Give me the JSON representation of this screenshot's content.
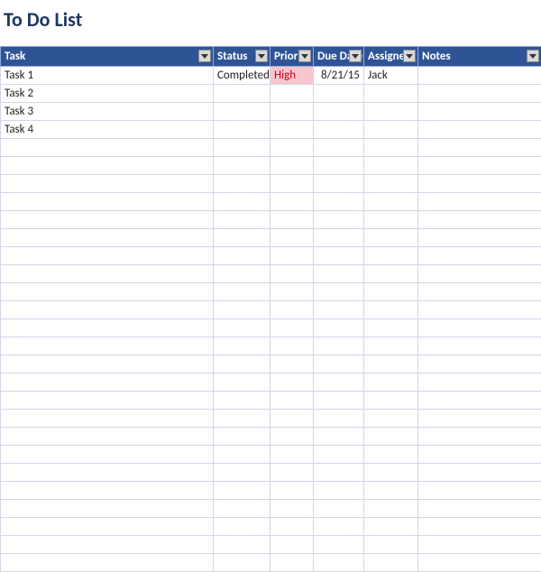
{
  "title": "To Do List",
  "columns": {
    "task": "Task",
    "status": "Status",
    "priority": "Priority",
    "duedate": "Due Date",
    "assignee": "Assignee",
    "notes": "Notes"
  },
  "rows": [
    {
      "task": "Task 1",
      "status": "Completed",
      "priority": "High",
      "duedate": "8/21/15",
      "assignee": "Jack",
      "notes": ""
    },
    {
      "task": "Task 2",
      "status": "",
      "priority": "",
      "duedate": "",
      "assignee": "",
      "notes": ""
    },
    {
      "task": "Task 3",
      "status": "",
      "priority": "",
      "duedate": "",
      "assignee": "",
      "notes": ""
    },
    {
      "task": "Task 4",
      "status": "",
      "priority": "",
      "duedate": "",
      "assignee": "",
      "notes": ""
    }
  ],
  "emptyRowCount": 24
}
